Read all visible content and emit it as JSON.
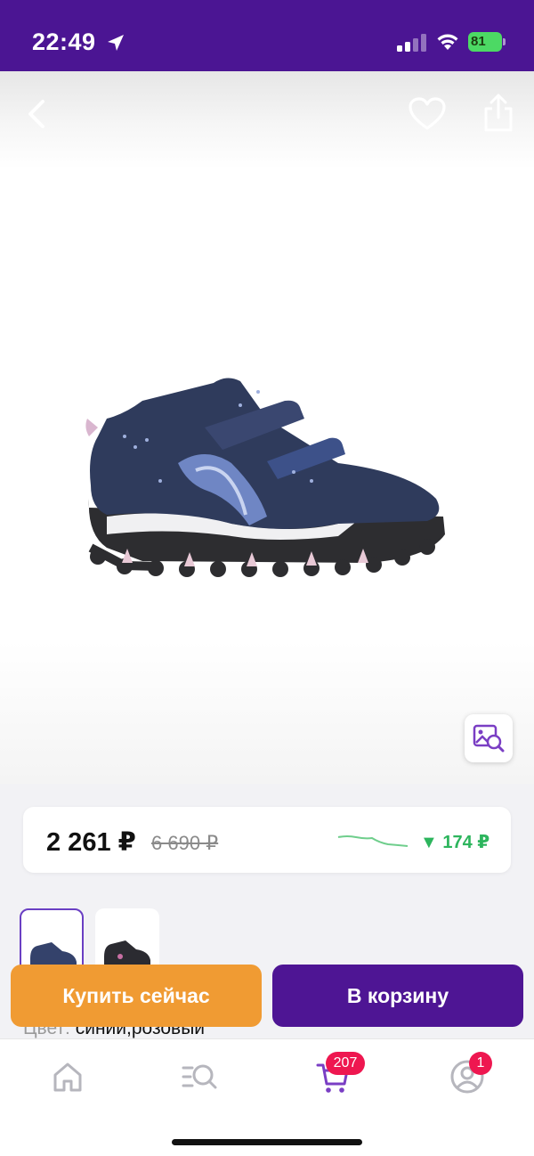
{
  "status_bar": {
    "time": "22:49",
    "battery_level": "81",
    "icons": [
      "location-arrow-icon",
      "signal-icon",
      "wifi-icon",
      "battery-charging-icon"
    ]
  },
  "product": {
    "image_icon": "shoe-image",
    "icons": [
      "back-icon",
      "heart-icon",
      "share-icon",
      "visual-search-icon"
    ],
    "thumbnails": [
      "thumb-shoe-blue",
      "thumb-shoe-dark"
    ]
  },
  "price": {
    "current": "2 261 ₽",
    "old": "6 690 ₽",
    "drop": "▼ 174 ₽",
    "trend_color": "#2db55d"
  },
  "actions": {
    "buy_now": "Купить сейчас",
    "add_to_cart": "В корзину"
  },
  "details": {
    "color_label": "Цвет:",
    "color_value": "синий,розовый"
  },
  "nav": {
    "items": [
      "home-icon",
      "catalog-search-icon",
      "cart-icon",
      "profile-icon"
    ],
    "cart_badge": "207",
    "profile_badge": "1"
  },
  "colors": {
    "brand": "#4b1593",
    "buy_now": "#f09b33",
    "add_cart": "#4e1594",
    "badge": "#ee1750"
  }
}
